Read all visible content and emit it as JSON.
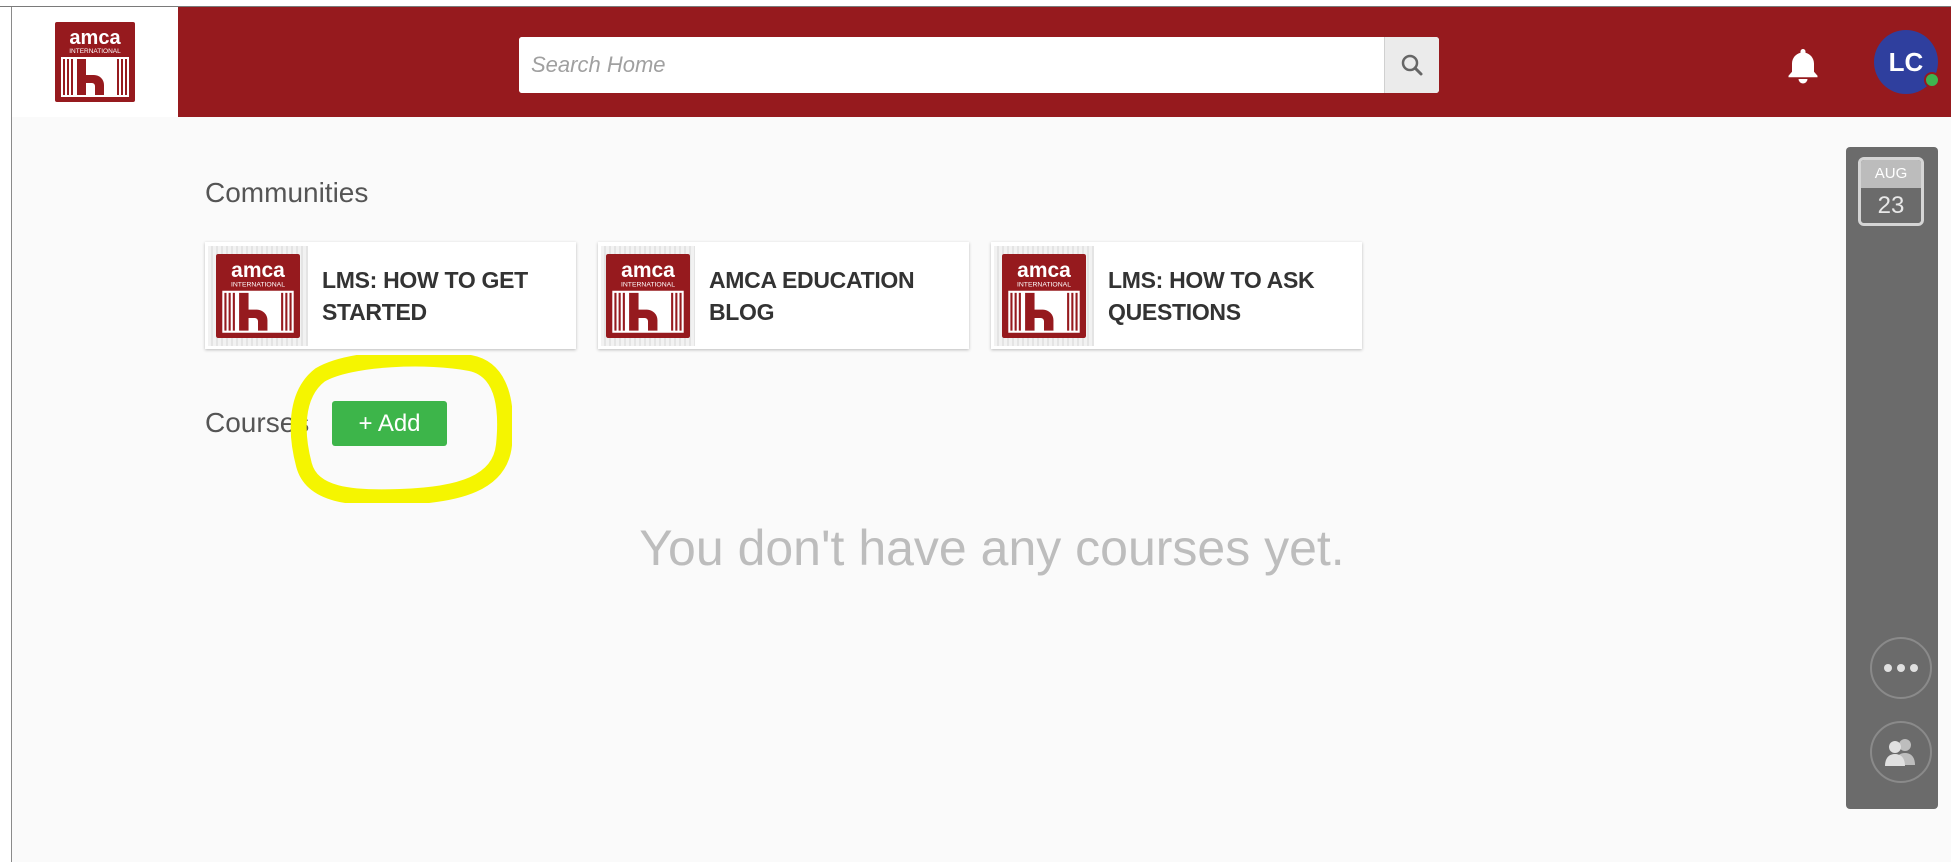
{
  "header": {
    "search_placeholder": "Search Home",
    "user_initials": "LC",
    "brand_color": "#961a1e",
    "logo_text_main": "amca",
    "logo_text_sub": "INTERNATIONAL"
  },
  "communities": {
    "title": "Communities",
    "items": [
      {
        "label_line1": "LMS: HOW TO GET",
        "label_line2": "STARTED"
      },
      {
        "label_line1": "AMCA EDUCATION BLOG",
        "label_line2": ""
      },
      {
        "label_line1": "LMS: HOW TO ASK",
        "label_line2": "QUESTIONS"
      }
    ]
  },
  "courses": {
    "title": "Courses",
    "add_label": "+ Add",
    "empty_message": "You don't have any courses yet.",
    "add_color": "#3db54a"
  },
  "rail": {
    "month": "AUG",
    "day": "23",
    "more_icon": "ellipsis-icon",
    "people_icon": "people-icon"
  }
}
